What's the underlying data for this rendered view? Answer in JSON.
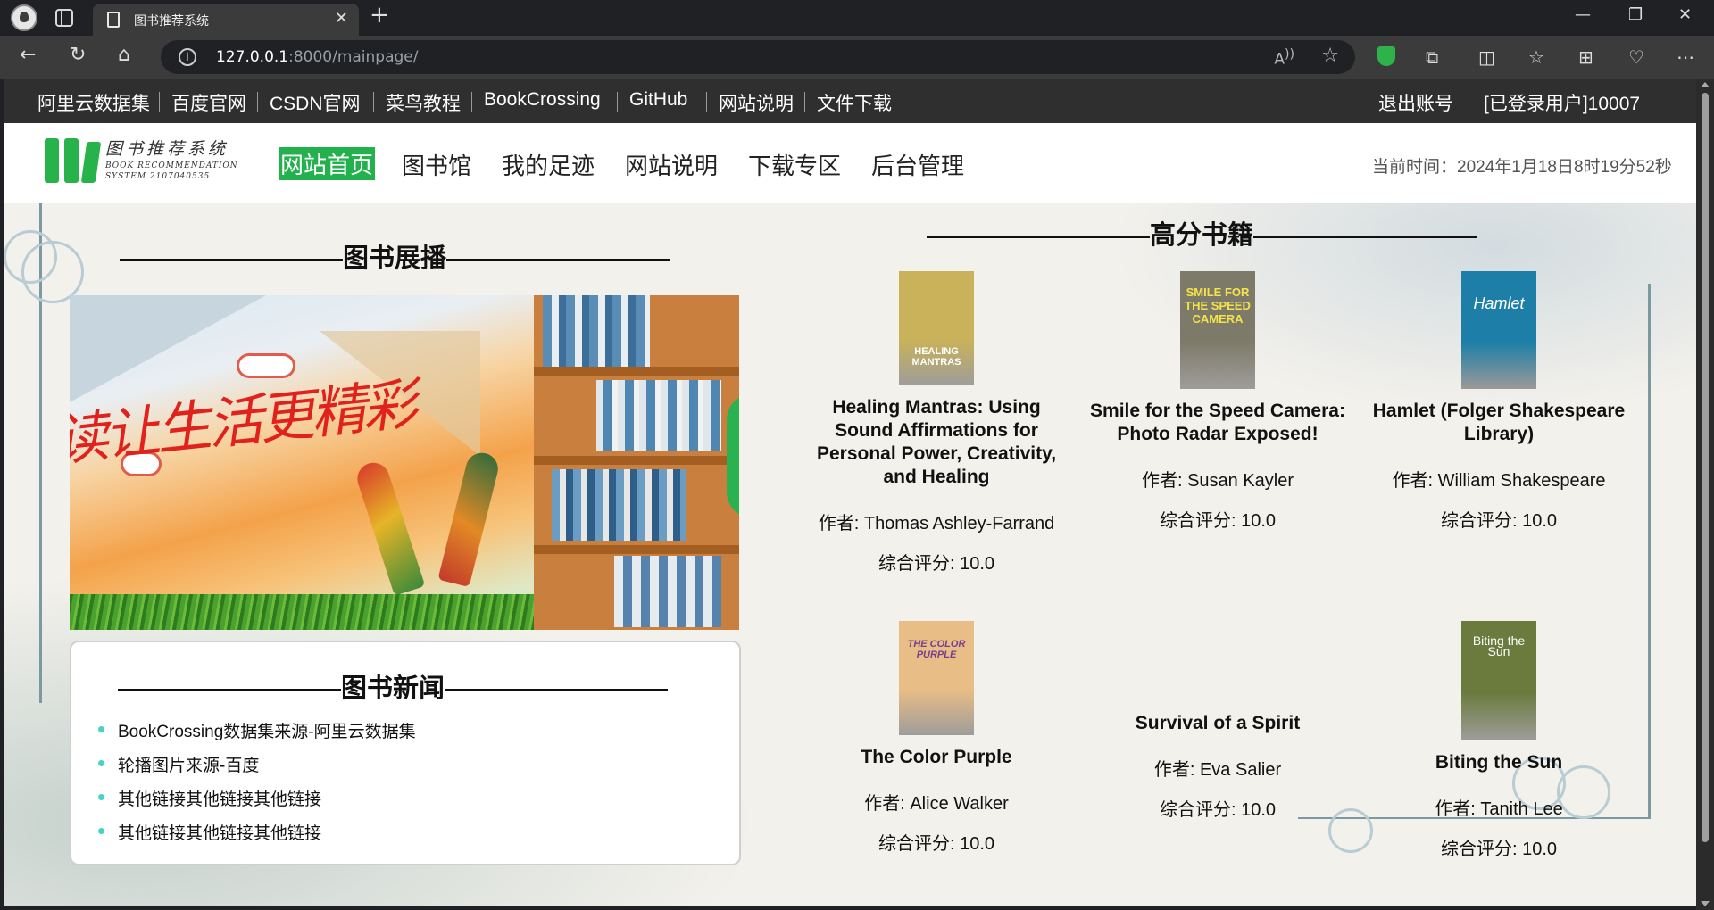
{
  "browser": {
    "tab_title": "图书推荐系统",
    "url_host": "127.0.0.1",
    "url_rest": ":8000/mainpage/"
  },
  "topbar": {
    "links": [
      "阿里云数据集",
      "百度官网",
      "CSDN官网",
      "菜鸟教程",
      "BookCrossing",
      "GitHub",
      "网站说明",
      "文件下载"
    ],
    "logout": "退出账号",
    "user": "[已登录用户]10007"
  },
  "header": {
    "logo_cn": "图书推荐系统",
    "logo_en1": "BOOK RECOMMENDATION",
    "logo_en2": "SYSTEM  2107040535",
    "nav": [
      "网站首页",
      "图书馆",
      "我的足迹",
      "网站说明",
      "下载专区",
      "后台管理"
    ],
    "clock": "当前时间：2024年1月18日8时19分52秒"
  },
  "carousel": {
    "title": "图书展播",
    "slogan": "读让生活更精彩"
  },
  "news": {
    "title": "图书新闻",
    "items": [
      "BookCrossing数据集来源-阿里云数据集",
      "轮播图片来源-百度",
      "其他链接其他链接其他链接",
      "其他链接其他链接其他链接"
    ]
  },
  "top_books": {
    "title": "高分书籍",
    "books": [
      {
        "title": "Healing Mantras: Using Sound Affirmations for Personal Power, Creativity, and Healing",
        "author": "作者: Thomas Ashley-Farrand",
        "score": "综合评分: 10.0",
        "cover_text": "HEALING MANTRAS",
        "cover_color": "#c9b25a"
      },
      {
        "title": "Smile for the Speed Camera: Photo Radar Exposed!",
        "author": "作者: Susan Kayler",
        "score": "综合评分: 10.0",
        "cover_text": "SMILE FOR THE SPEED CAMERA",
        "cover_color": "#7e7a6a"
      },
      {
        "title": "Hamlet (Folger Shakespeare Library)",
        "author": "作者: William Shakespeare",
        "score": "综合评分: 10.0",
        "cover_text": "Hamlet",
        "cover_color": "#1d7fa7"
      },
      {
        "title": "The Color Purple",
        "author": "作者: Alice Walker",
        "score": "综合评分: 10.0",
        "cover_text": "THE COLOR PURPLE",
        "cover_color": "#e9bd86"
      },
      {
        "title": "Survival of a Spirit",
        "author": "作者: Eva Salier",
        "score": "综合评分: 10.0",
        "cover_text": "",
        "cover_color": ""
      },
      {
        "title": "Biting the Sun",
        "author": "作者: Tanith Lee",
        "score": "综合评分: 10.0",
        "cover_text": "Biting the Sun",
        "cover_color": "#6b7b3e"
      }
    ]
  }
}
